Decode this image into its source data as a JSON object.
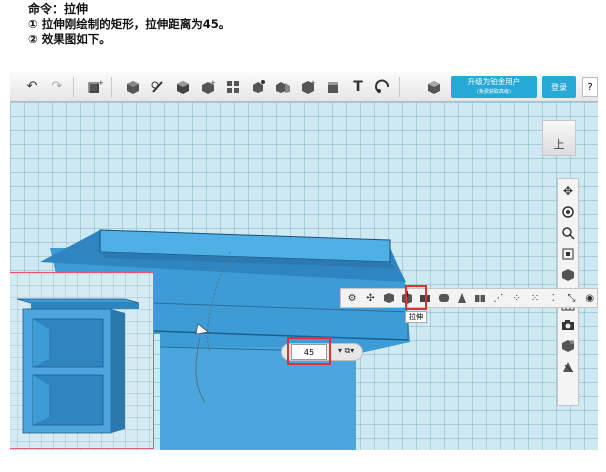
{
  "instructions": {
    "command": "命令：拉伸",
    "step1": "① 拉伸刚绘制的矩形，拉伸距离为45。",
    "step2": "② 效果图如下。"
  },
  "toolbar": {
    "undo_icon": "↶",
    "redo_icon": "↷",
    "text_tool": "T",
    "upgrade_label": "升级为铂金用户",
    "upgrade_sub": "(免费获取高级)",
    "login_label": "登录",
    "help_label": "?"
  },
  "viewcube": {
    "face_label": "上"
  },
  "feature_toolbar": {
    "extrude_tooltip": "拉伸"
  },
  "extrude_input": {
    "distance": "45"
  },
  "colors": {
    "model": "#3d9bd6",
    "highlight": "#e03030",
    "accent": "#26a9d6"
  }
}
